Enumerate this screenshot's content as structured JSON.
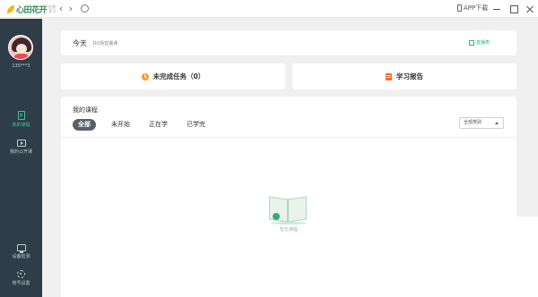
{
  "titlebar": {
    "logo_main": "心田花开",
    "logo_sub": "在线学习",
    "back": "‹",
    "forward": "›",
    "app_download": "APP下载"
  },
  "sidebar": {
    "username": "135***3",
    "items": [
      {
        "label": "我的课程",
        "active": true
      },
      {
        "label": "我的公开课",
        "active": false
      },
      {
        "label": "设备检测",
        "active": false
      },
      {
        "label": "账号设置",
        "active": false
      }
    ]
  },
  "today": {
    "title": "今天",
    "subtitle": "共0场直播课",
    "live_link": "直播表"
  },
  "tasks": {
    "label": "未完成任务（0）"
  },
  "report": {
    "label": "学习报告"
  },
  "courses": {
    "title": "我的课程",
    "tabs": [
      "全部",
      "未开始",
      "正在学",
      "已学完"
    ],
    "active_tab": "全部",
    "filter": "全部类别",
    "empty_text": "暂无课程"
  },
  "colors": {
    "sidebar_bg": "#2e3d47",
    "accent_green": "#2db37f",
    "task_orange": "#f39c21",
    "report_orange": "#f36b2a",
    "active_tab_bg": "#57606a"
  }
}
